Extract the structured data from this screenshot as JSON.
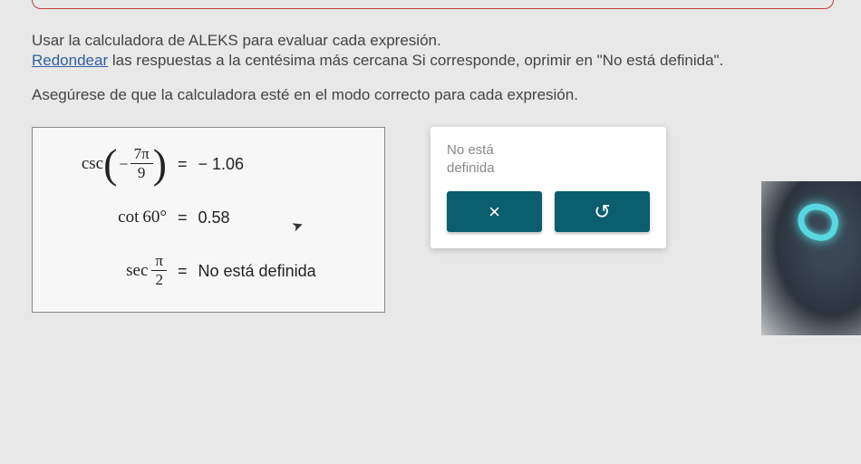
{
  "instructions": {
    "line1": "Usar la calculadora de ALEKS para evaluar cada expresión.",
    "line2_link": "Redondear",
    "line2_rest": " las respuestas a la centésima más cercana Si corresponde, oprimir en \"No está definida\".",
    "line3": "Asegúrese de que la calculadora esté en el modo correcto para cada expresión."
  },
  "expressions": [
    {
      "fn": "csc",
      "arg_neg": "−",
      "arg_num": "7π",
      "arg_den": "9",
      "result": "− 1.06"
    },
    {
      "fn": "cot",
      "arg_plain": "60°",
      "result": "0.58"
    },
    {
      "fn": "sec",
      "arg_num": "π",
      "arg_den": "2",
      "result": "No está definida"
    }
  ],
  "panel": {
    "text_line1": "No está",
    "text_line2": "definida",
    "x_label": "×",
    "reset_label": "↺"
  }
}
